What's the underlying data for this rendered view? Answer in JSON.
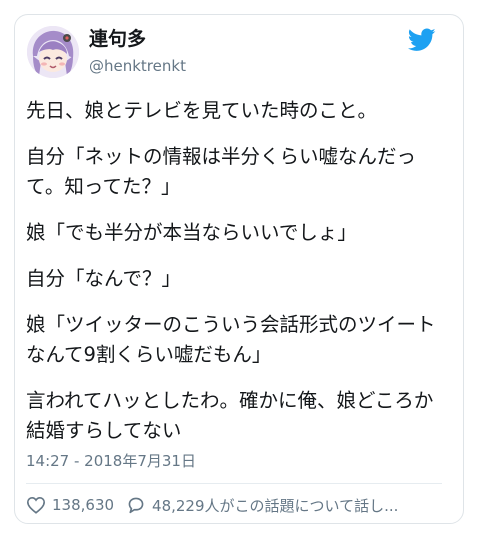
{
  "user": {
    "display_name": "連句多",
    "handle": "@henktrenkt"
  },
  "tweet": {
    "paragraphs": [
      "先日、娘とテレビを見ていた時のこと。",
      "自分「ネットの情報は半分くらい嘘なんだっ\nて。知ってた？」",
      "娘「でも半分が本当ならいいでしょ」",
      "自分「なんで？」",
      "娘「ツイッターのこういう会話形式のツイート\nなんて9割くらい嘘だもん」",
      "言われてハッとしたわ。確かに俺、娘どころか\n結婚すらしてない"
    ],
    "timestamp": "14:27 - 2018年7月31日"
  },
  "actions": {
    "likes": "138,630",
    "replies": "48,229人がこの話題について話し..."
  },
  "colors": {
    "brand": "#1da1f2",
    "text": "#14171a",
    "muted": "#657786"
  },
  "icons": {
    "brand": "twitter-bird-icon",
    "like": "heart-icon",
    "reply": "speech-bubble-icon"
  }
}
